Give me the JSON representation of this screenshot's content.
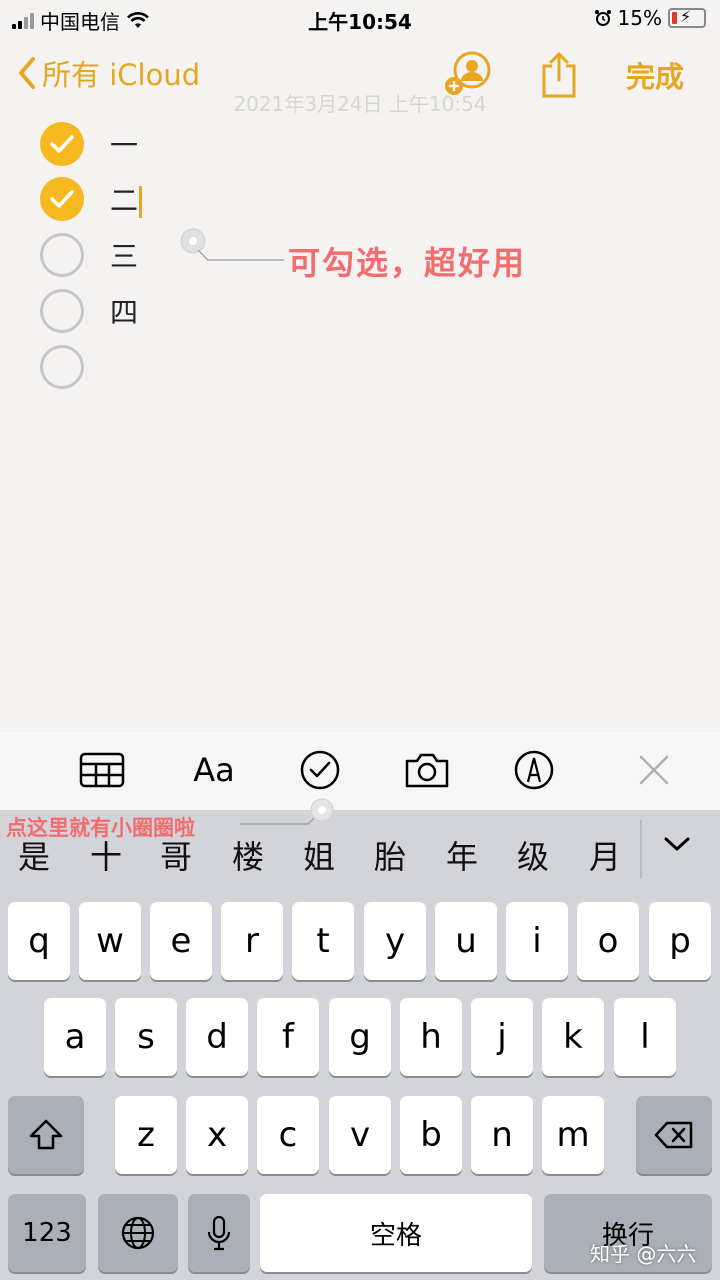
{
  "status_bar": {
    "carrier": "中国电信",
    "time": "上午10:54",
    "battery": "15%"
  },
  "nav": {
    "back_label": "所有 iCloud",
    "done_label": "完成",
    "faded_date": "2021年3月24日 上午10:54"
  },
  "checklist": [
    {
      "text": "一",
      "checked": true
    },
    {
      "text": "二",
      "checked": true
    },
    {
      "text": "三",
      "checked": false
    },
    {
      "text": "四",
      "checked": false
    },
    {
      "text": "",
      "checked": false
    }
  ],
  "annotations": {
    "note_area": "可勾选，超好用",
    "toolbar_hint": "点这里就有小圈圈啦"
  },
  "toolbar": {
    "format_label": "Aa",
    "icons": [
      "table-icon",
      "format-icon",
      "checklist-icon",
      "camera-icon",
      "markup-icon",
      "close-icon"
    ]
  },
  "candidates": [
    "是",
    "十",
    "哥",
    "楼",
    "姐",
    "胎",
    "年",
    "级",
    "月"
  ],
  "keyboard": {
    "row1": [
      "q",
      "w",
      "e",
      "r",
      "t",
      "y",
      "u",
      "i",
      "o",
      "p"
    ],
    "row2": [
      "a",
      "s",
      "d",
      "f",
      "g",
      "h",
      "j",
      "k",
      "l"
    ],
    "row3": [
      "z",
      "x",
      "c",
      "v",
      "b",
      "n",
      "m"
    ],
    "numbers_label": "123",
    "space_label": "空格",
    "return_label": "换行"
  },
  "watermark": "知乎 @六六",
  "colors": {
    "accent": "#e6a61f",
    "checked": "#f6b91f",
    "annotation": "#f26d6d"
  }
}
